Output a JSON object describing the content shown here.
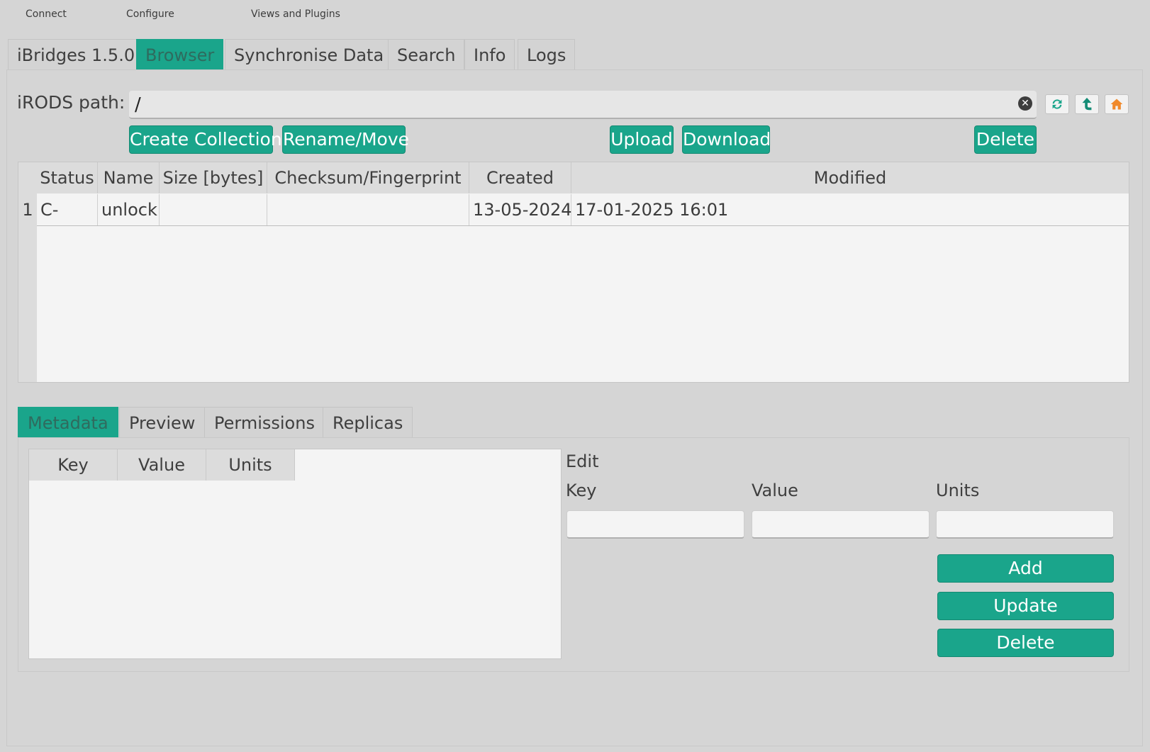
{
  "menu": [
    "Connect",
    "Configure",
    "Views and Plugins"
  ],
  "main_tabs": [
    "iBridges 1.5.0",
    "Browser",
    "Synchronise Data",
    "Search",
    "Info",
    "Logs"
  ],
  "active_main_tab": "Browser",
  "browser": {
    "path_label": "iRODS path:",
    "path_value": "/",
    "buttons": {
      "create_collection": "Create Collection",
      "rename_move": "Rename/Move",
      "upload": "Upload",
      "download": "Download",
      "delete": "Delete"
    },
    "table": {
      "columns": [
        "Status",
        "Name",
        "Size [bytes]",
        "Checksum/Fingerprint",
        "Created",
        "Modified"
      ],
      "rows": [
        {
          "index": "1",
          "status": "C-",
          "name": "unlock",
          "size": "",
          "checksum": "",
          "created": "13-05-2024",
          "modified": "17-01-2025 16:01"
        }
      ]
    }
  },
  "sub_tabs": [
    "Metadata",
    "Preview",
    "Permissions",
    "Replicas"
  ],
  "active_sub_tab": "Metadata",
  "metadata": {
    "columns": [
      "Key",
      "Value",
      "Units"
    ],
    "edit": {
      "title": "Edit",
      "key_label": "Key",
      "value_label": "Value",
      "units_label": "Units",
      "add": "Add",
      "update": "Update",
      "delete": "Delete"
    }
  },
  "colors": {
    "accent": "#1aa58b",
    "background": "#d5d5d5"
  },
  "icons": [
    "clear-icon",
    "refresh-icon",
    "parent-folder-icon",
    "home-icon"
  ]
}
